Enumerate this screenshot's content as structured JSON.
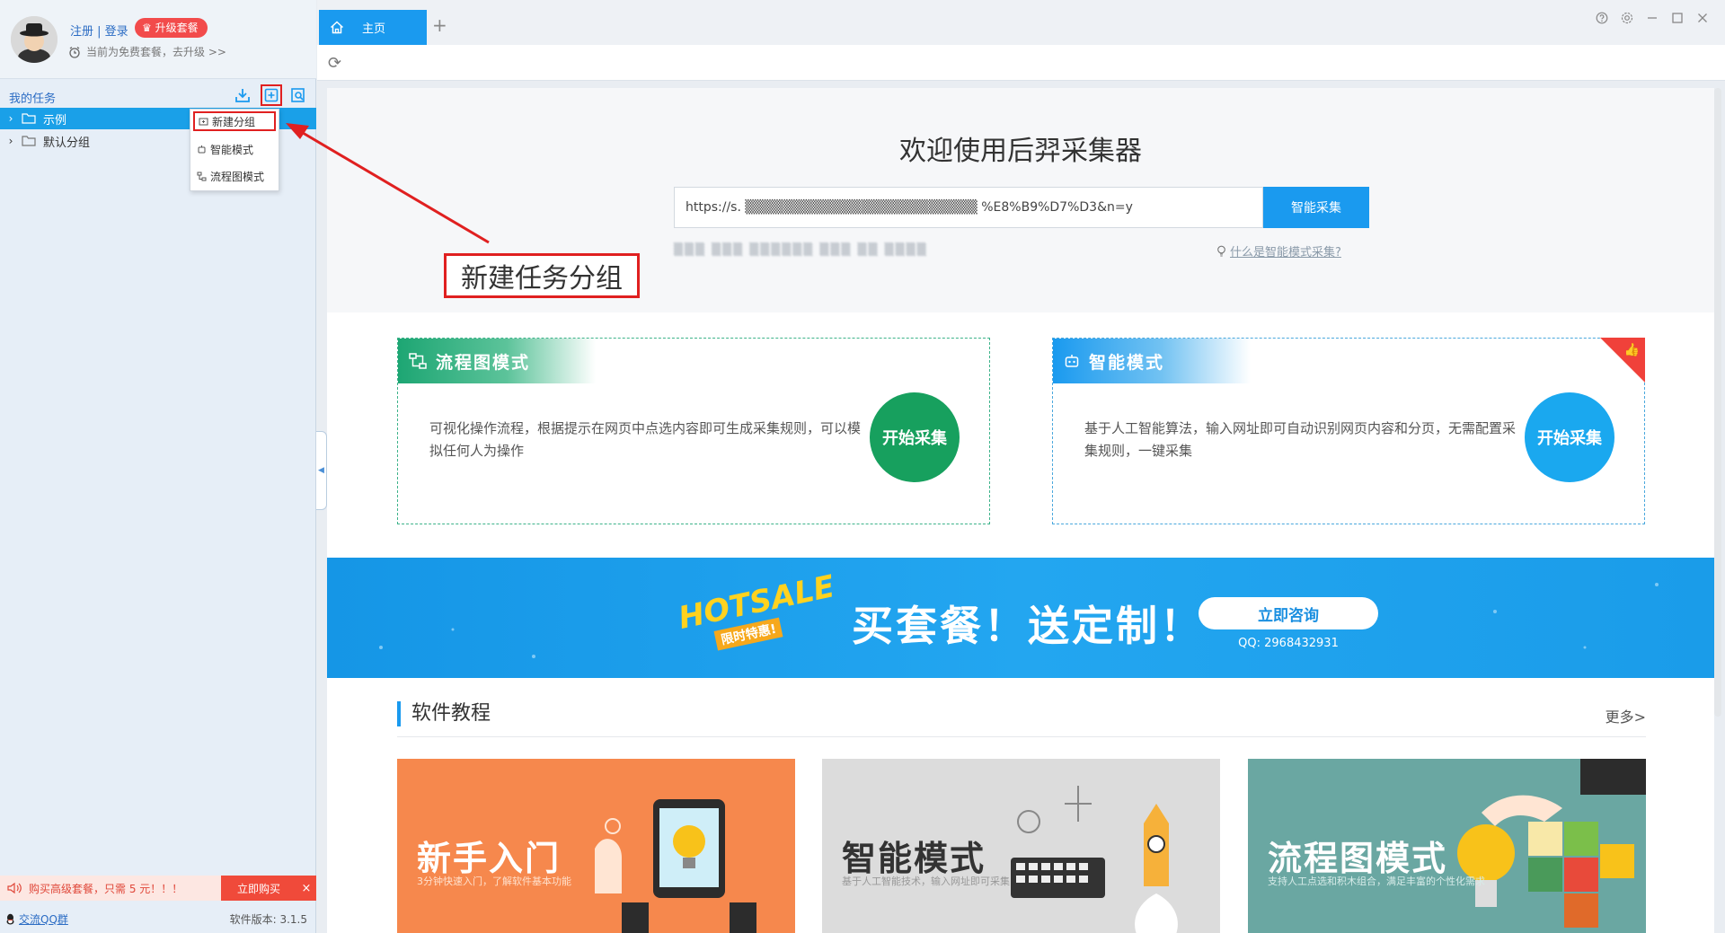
{
  "user": {
    "login": "注册 | 登录",
    "upgrade": "升级套餐",
    "plan_status": "当前为免费套餐，去升级 >>"
  },
  "sidebar": {
    "tasks_title": "我的任务",
    "tree": [
      {
        "label": "示例",
        "selected": true
      },
      {
        "label": "默认分组",
        "selected": false
      }
    ],
    "context_menu": [
      "新建分组",
      "智能模式",
      "流程图模式"
    ],
    "promo_text": "购买高级套餐，只需 5 元！！！",
    "promo_buy": "立即购买",
    "promo_close": "×",
    "qq_group": "交流QQ群",
    "version": "软件版本: 3.1.5"
  },
  "tabs": {
    "home": "主页",
    "add": "+"
  },
  "main": {
    "welcome": "欢迎使用后羿采集器",
    "url_value": "https://s. ▒▒▒▒▒▒▒▒▒▒▒▒▒▒▒▒▒▒▒▒▒▒▒▒ %E8%B9%D7%D3&n=y",
    "smart_button": "智能采集",
    "recent_urls": "▒▒▒ ▒▒▒ ▒▒▒▒▒▒ ▒▒▒ ▒▒ ▒▒▒▒",
    "help_link": "什么是智能模式采集?",
    "cards": [
      {
        "title": "流程图模式",
        "desc": "可视化操作流程，根据提示在网页中点选内容即可生成采集规则，可以模拟任何人为操作",
        "button": "开始采集"
      },
      {
        "title": "智能模式",
        "desc": "基于人工智能算法，输入网址即可自动识别网页内容和分页，无需配置采集规则，一键采集",
        "button": "开始采集"
      }
    ],
    "banner": {
      "logo_hot": "HOTSALE",
      "logo_sub": "限时特惠!",
      "slogan": "买套餐！送定制！",
      "consult": "立即咨询",
      "qq": "QQ: 2968432931"
    },
    "tutorials": {
      "title": "软件教程",
      "more": "更多>",
      "items": [
        {
          "label": "新手入门",
          "sub": "3分钟快速入门，了解软件基本功能"
        },
        {
          "label": "智能模式",
          "sub": "基于人工智能技术，输入网址即可采集"
        },
        {
          "label": "流程图模式",
          "sub": "支持人工点选和积木组合，满足丰富的个性化需求"
        }
      ]
    }
  },
  "annotation": {
    "label": "新建任务分组",
    "color": "#e02020"
  },
  "colors": {
    "accent": "#1a9aef",
    "green": "#17a05e",
    "promo_red": "#f04a3a"
  }
}
